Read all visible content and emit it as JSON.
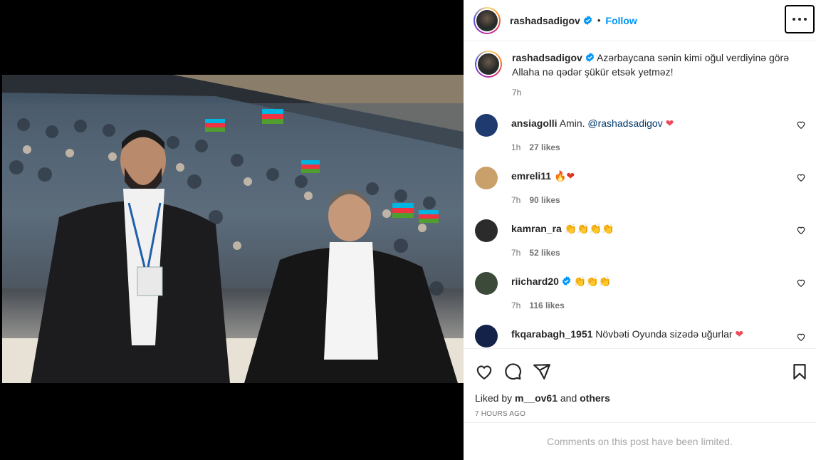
{
  "post": {
    "username": "rashadsadigov",
    "follow_label": "Follow",
    "dot": "•",
    "caption_username": "rashadsadigov",
    "caption": "Azərbaycana sənin kimi oğul verdiyinə görə Allaha nə qədər şükür etsək yetməz!",
    "caption_time": "7h"
  },
  "comments": [
    {
      "user": "ansiagolli",
      "text": "Amin.",
      "mention": "@rashadsadigov",
      "emoji": "❤",
      "time": "1h",
      "likes": "27 likes",
      "avatar_color": "#1e3a6e"
    },
    {
      "user": "emreli11",
      "text": "",
      "mention": "",
      "emoji": "🔥❤",
      "time": "7h",
      "likes": "90 likes",
      "avatar_color": "#c9a06a"
    },
    {
      "user": "kamran_ra",
      "text": "",
      "mention": "",
      "emoji": "👏👏👏👏",
      "time": "7h",
      "likes": "52 likes",
      "avatar_color": "#2b2b2b"
    },
    {
      "user": "riichard20",
      "text": "",
      "mention": "",
      "emoji": "👏👏👏",
      "time": "7h",
      "likes": "116 likes",
      "avatar_color": "#3c4a3a",
      "verified": true
    },
    {
      "user": "fkqarabagh_1951",
      "text": "Növbəti Oyunda sizədə uğurlar",
      "mention": "",
      "emoji": "❤",
      "time": "",
      "likes": "",
      "avatar_color": "#14224a"
    }
  ],
  "liked_by": {
    "prefix": "Liked by ",
    "user": "m__ov61",
    "middle": " and ",
    "others": "others"
  },
  "ago": "7 HOURS AGO",
  "limited": "Comments on this post have been limited.",
  "colors": {
    "accent": "#0095f6",
    "verified": "#0095f6",
    "heart": "#ed4956"
  }
}
